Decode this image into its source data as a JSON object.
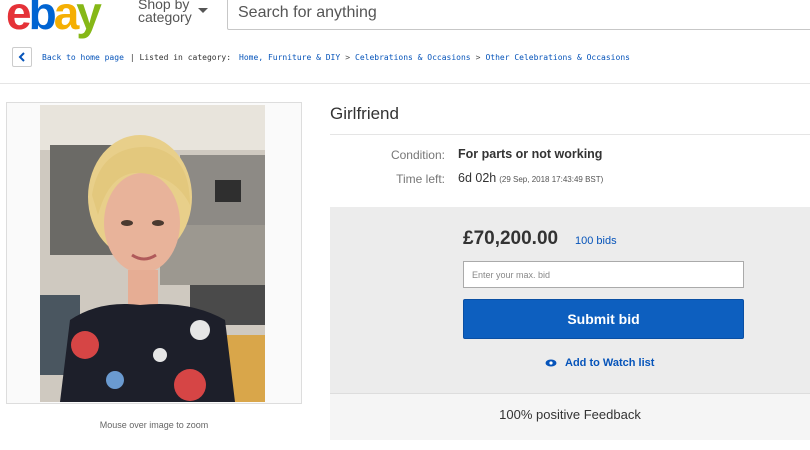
{
  "header": {
    "logo_letters": [
      "e",
      "b",
      "a",
      "y"
    ],
    "logo_colors": [
      "#e53238",
      "#0064d2",
      "#f5af02",
      "#86b817"
    ],
    "shop_by_line1": "Shop by",
    "shop_by_line2": "category",
    "search_placeholder": "Search for anything"
  },
  "breadcrumb": {
    "back_label": "Back to home page",
    "listed_label": "| Listed in category:",
    "categories": [
      "Home, Furniture & DIY",
      "Celebrations & Occasions",
      "Other Celebrations & Occasions"
    ],
    "separator": ">"
  },
  "image": {
    "caption": "Mouse over image to zoom"
  },
  "item": {
    "title": "Girlfriend",
    "condition_label": "Condition:",
    "condition_value": "For parts or not working",
    "time_label": "Time left:",
    "time_value": "6d 02h",
    "time_detail": "(29 Sep, 2018  17:43:49 BST)"
  },
  "bid": {
    "price": "£70,200.00",
    "bids_count": "100 bids",
    "max_bid_placeholder": "Enter your max. bid",
    "submit_label": "Submit bid",
    "watch_label": "Add to Watch list"
  },
  "feedback": {
    "text": "100% positive Feedback"
  },
  "colors": {
    "link": "#0654ba",
    "submit": "#0d5fbf",
    "panel": "#ececec"
  }
}
